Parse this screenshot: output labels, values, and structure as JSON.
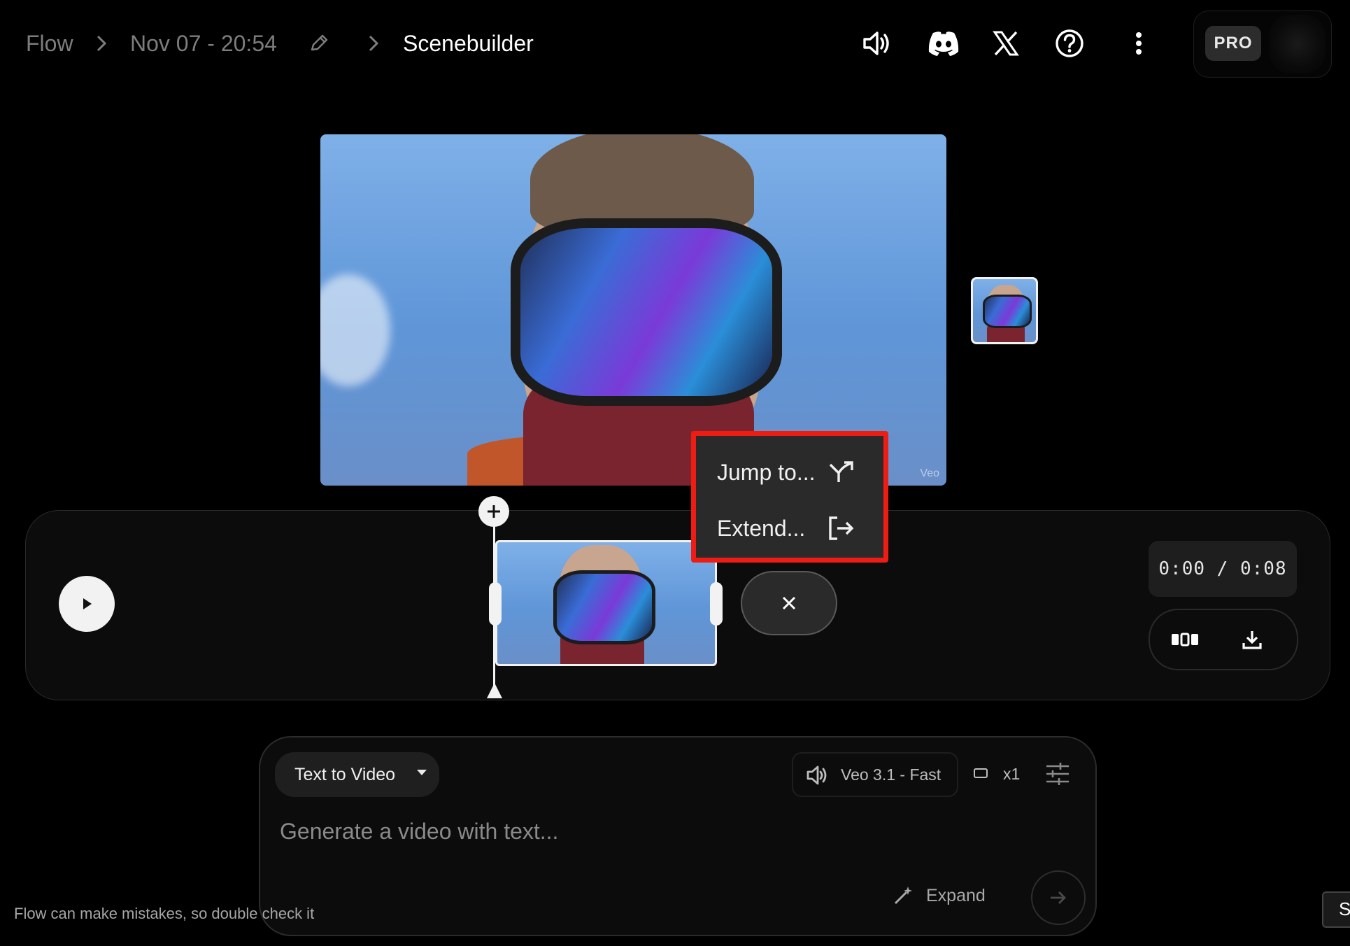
{
  "header": {
    "breadcrumbs": [
      {
        "label": "Flow"
      },
      {
        "label": "Nov 07 - 20:54"
      },
      {
        "label": "Scenebuilder"
      }
    ],
    "icons": [
      "volume-icon",
      "discord-icon",
      "x-logo-icon",
      "help-icon",
      "more-vert-icon"
    ],
    "badge": "PRO"
  },
  "preview": {
    "watermark": "Veo"
  },
  "context_menu": {
    "items": [
      {
        "label": "Jump to...",
        "icon": "branch-icon"
      },
      {
        "label": "Extend...",
        "icon": "exit-arrow-icon"
      }
    ],
    "highlight_color": "#ee1c13"
  },
  "timeline": {
    "time_readout": "0:00 / 0:08"
  },
  "prompt": {
    "mode_label": "Text to Video",
    "model_label": "Veo 3.1 - Fast",
    "count_label": "x1",
    "placeholder": "Generate a video with text...",
    "expand_label": "Expand"
  },
  "footer": {
    "disclaimer": "Flow can make mistakes, so double check it",
    "corner_label": "S"
  }
}
